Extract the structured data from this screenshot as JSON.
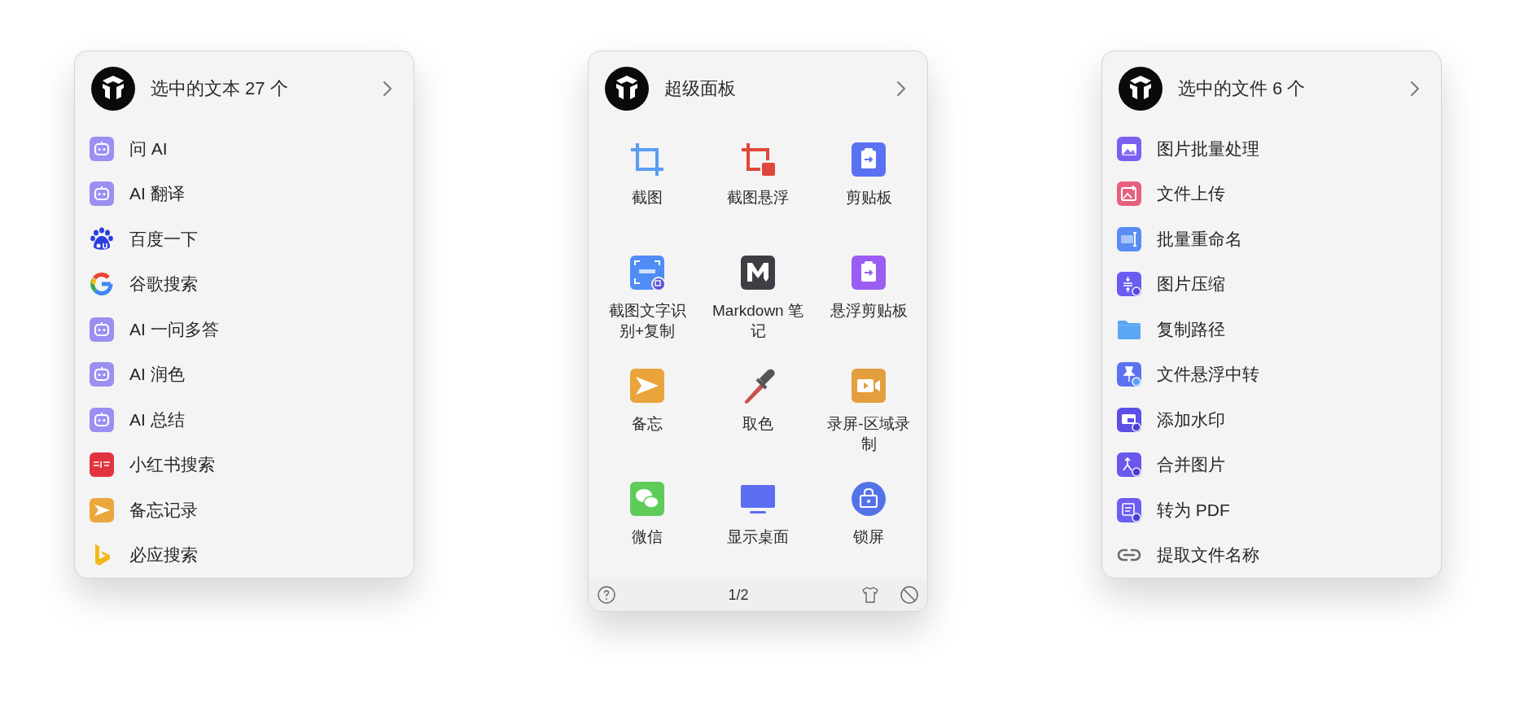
{
  "panels": [
    {
      "kind": "list",
      "title": "选中的文本 27 个",
      "items": [
        {
          "label": "问 AI"
        },
        {
          "label": "AI 翻译"
        },
        {
          "label": "百度一下"
        },
        {
          "label": "谷歌搜索"
        },
        {
          "label": "AI 一问多答"
        },
        {
          "label": "AI 润色"
        },
        {
          "label": "AI 总结"
        },
        {
          "label": "小红书搜索"
        },
        {
          "label": "备忘记录"
        },
        {
          "label": "必应搜索"
        }
      ]
    },
    {
      "kind": "grid",
      "title": "超级面板",
      "items": [
        {
          "label": "截图"
        },
        {
          "label": "截图悬浮"
        },
        {
          "label": "剪贴板"
        },
        {
          "label": "截图文字识别+复制"
        },
        {
          "label": "Markdown 笔记"
        },
        {
          "label": "悬浮剪贴板"
        },
        {
          "label": "备忘"
        },
        {
          "label": "取色"
        },
        {
          "label": "录屏-区域录制"
        },
        {
          "label": "微信"
        },
        {
          "label": "显示桌面"
        },
        {
          "label": "锁屏"
        }
      ],
      "footer": {
        "page": "1/2"
      }
    },
    {
      "kind": "list",
      "title": "选中的文件 6 个",
      "items": [
        {
          "label": "图片批量处理"
        },
        {
          "label": "文件上传"
        },
        {
          "label": "批量重命名"
        },
        {
          "label": "图片压缩"
        },
        {
          "label": "复制路径"
        },
        {
          "label": "文件悬浮中转"
        },
        {
          "label": "添加水印"
        },
        {
          "label": "合并图片"
        },
        {
          "label": "转为 PDF"
        },
        {
          "label": "提取文件名称"
        }
      ]
    }
  ]
}
